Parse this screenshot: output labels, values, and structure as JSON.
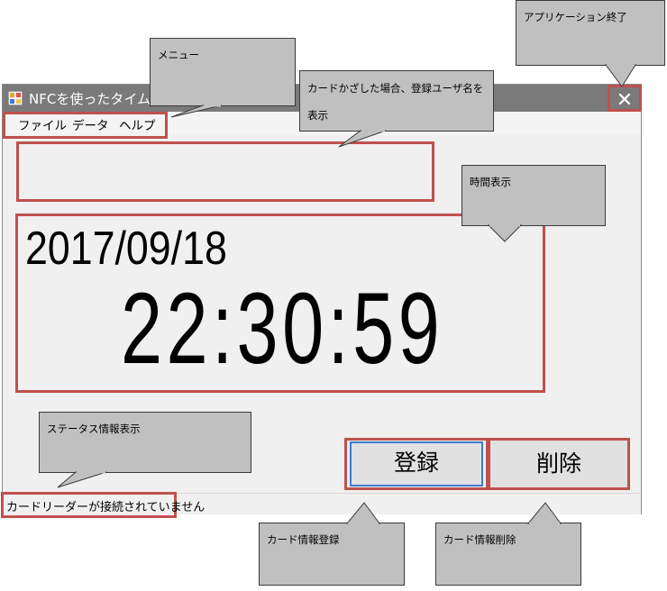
{
  "window": {
    "title": "NFCを使ったタイムレコーダ",
    "close_glyph": "✕"
  },
  "menu": {
    "items": [
      {
        "label": "ファイル"
      },
      {
        "label": "データ"
      },
      {
        "label": "ヘルプ"
      }
    ]
  },
  "display": {
    "user_name": "",
    "date": "2017/09/18",
    "time": "22:30:59"
  },
  "buttons": {
    "register_label": "登録",
    "delete_label": "削除"
  },
  "status": {
    "text": "カードリーダーが接続されていません"
  },
  "callouts": {
    "menu": "メニュー",
    "close": "アプリケーション終了",
    "user_name": "カードかざした場合、登録ユーザ名を表示",
    "time": "時間表示",
    "status": "ステータス情報表示",
    "register": "カード情報登録",
    "delete": "カード情報削除"
  },
  "colors": {
    "highlight": "#c0504d",
    "titlebar": "#7a7a7a",
    "callout_fill": "#c0c0c0",
    "focus_border": "#3a7bd5"
  }
}
